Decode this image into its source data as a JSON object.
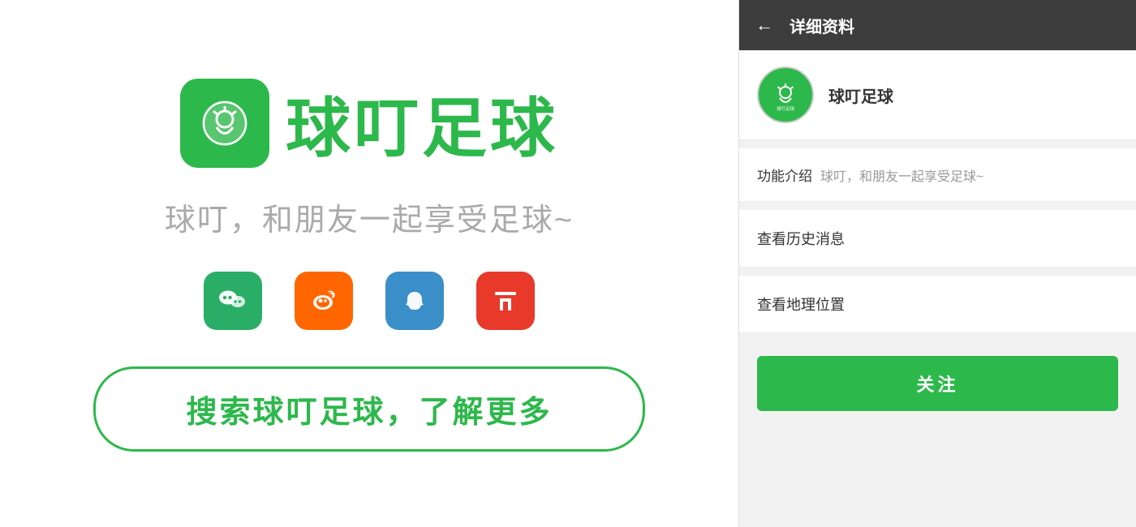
{
  "left": {
    "app_title": "球叮足球",
    "subtitle": "球叮，和朋友一起享受足球~",
    "search_button_label": "搜索球叮足球，了解更多",
    "social_icons": [
      {
        "name": "wechat",
        "label": "微信"
      },
      {
        "name": "weibo",
        "label": "微博"
      },
      {
        "name": "snapchat",
        "label": "快照"
      },
      {
        "name": "toutiao",
        "label": "头条"
      }
    ]
  },
  "right": {
    "header": {
      "back_label": "←",
      "title": "详细资料"
    },
    "profile": {
      "name": "球叮足球"
    },
    "info": {
      "label": "功能介绍",
      "value": "球叮，和朋友一起享受足球~"
    },
    "menu_items": [
      {
        "label": "查看历史消息"
      },
      {
        "label": "查看地理位置"
      }
    ],
    "follow_button_label": "关注"
  }
}
